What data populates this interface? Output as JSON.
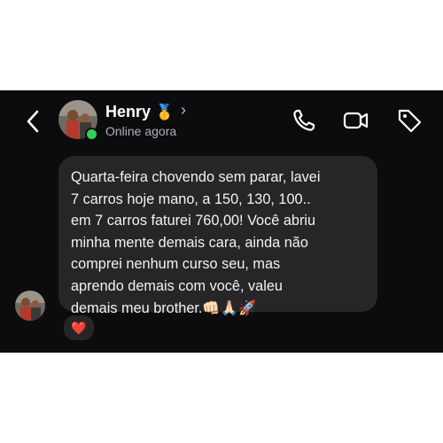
{
  "header": {
    "contact_name": "Henry",
    "name_badge": "🥇",
    "chevron": "›",
    "status": "Online agora",
    "status_color": "#2fd15a",
    "icons": [
      "back-chevron-icon",
      "phone-icon",
      "video-camera-icon",
      "tag-icon"
    ]
  },
  "message": {
    "lines": [
      "Quarta-feira chovendo sem parar, lavei",
      "7 carros hoje mano, a 150, 130, 100..",
      "em 7 carros faturei 760,00! Você abriu",
      "minha mente demais cara, ainda não",
      "comprei nenhum curso seu, mas",
      "aprendo demais com você, valeu",
      "demais meu brother.👊🏻🙏🏻🚀"
    ],
    "reaction": "❤️"
  },
  "colors": {
    "background": "#0c0c0f",
    "bubble": "#262629",
    "text": "#f2f2f2"
  }
}
